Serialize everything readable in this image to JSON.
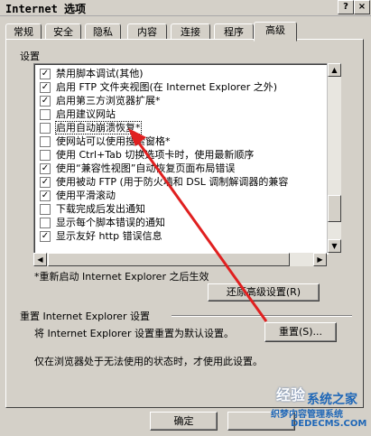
{
  "window": {
    "title": "Internet 选项",
    "help_label": "?",
    "close_label": "×"
  },
  "tabs": [
    {
      "label": "常规"
    },
    {
      "label": "安全"
    },
    {
      "label": "隐私"
    },
    {
      "label": "内容"
    },
    {
      "label": "连接"
    },
    {
      "label": "程序"
    },
    {
      "label": "高级",
      "active": true
    }
  ],
  "settings": {
    "label": "设置",
    "options": [
      {
        "label": "禁用脚本调试(其他)",
        "checked": true
      },
      {
        "label": "启用 FTP 文件夹视图(在 Internet Explorer 之外)",
        "checked": true
      },
      {
        "label": "启用第三方浏览器扩展*",
        "checked": true
      },
      {
        "label": "启用建议网站",
        "checked": false
      },
      {
        "label": "启用自动崩溃恢复*",
        "checked": false,
        "selected": true
      },
      {
        "label": "使网站可以使用搜索窗格*",
        "checked": false
      },
      {
        "label": "使用 Ctrl+Tab 切换选项卡时，使用最新顺序",
        "checked": false
      },
      {
        "label": "使用“兼容性视图”自动恢复页面布局错误",
        "checked": true
      },
      {
        "label": "使用被动 FTP (用于防火墙和 DSL 调制解调器的兼容",
        "checked": true
      },
      {
        "label": "使用平滑滚动",
        "checked": true
      },
      {
        "label": "下载完成后发出通知",
        "checked": false
      },
      {
        "label": "显示每个脚本错误的通知",
        "checked": false
      },
      {
        "label": "显示友好 http 错误信息",
        "checked": true
      }
    ],
    "note": "*重新启动 Internet Explorer 之后生效",
    "restore_button": "还原高级设置(R)"
  },
  "reset": {
    "group_label": "重置 Internet Explorer 设置",
    "description": "将 Internet Explorer 设置重置为默认设置。",
    "button": "重置(S)...",
    "footnote": "仅在浏览器处于无法使用的状态时，才使用此设置。"
  },
  "footer": {
    "ok_button": "确定"
  },
  "watermark": {
    "text1": "经验",
    "text2": "系统之家",
    "site_cn": "织梦内容管理系统",
    "site_url": "DEDECMS.COM"
  },
  "colors": {
    "face": "#d4d0c8",
    "arrow": "#e02020"
  }
}
